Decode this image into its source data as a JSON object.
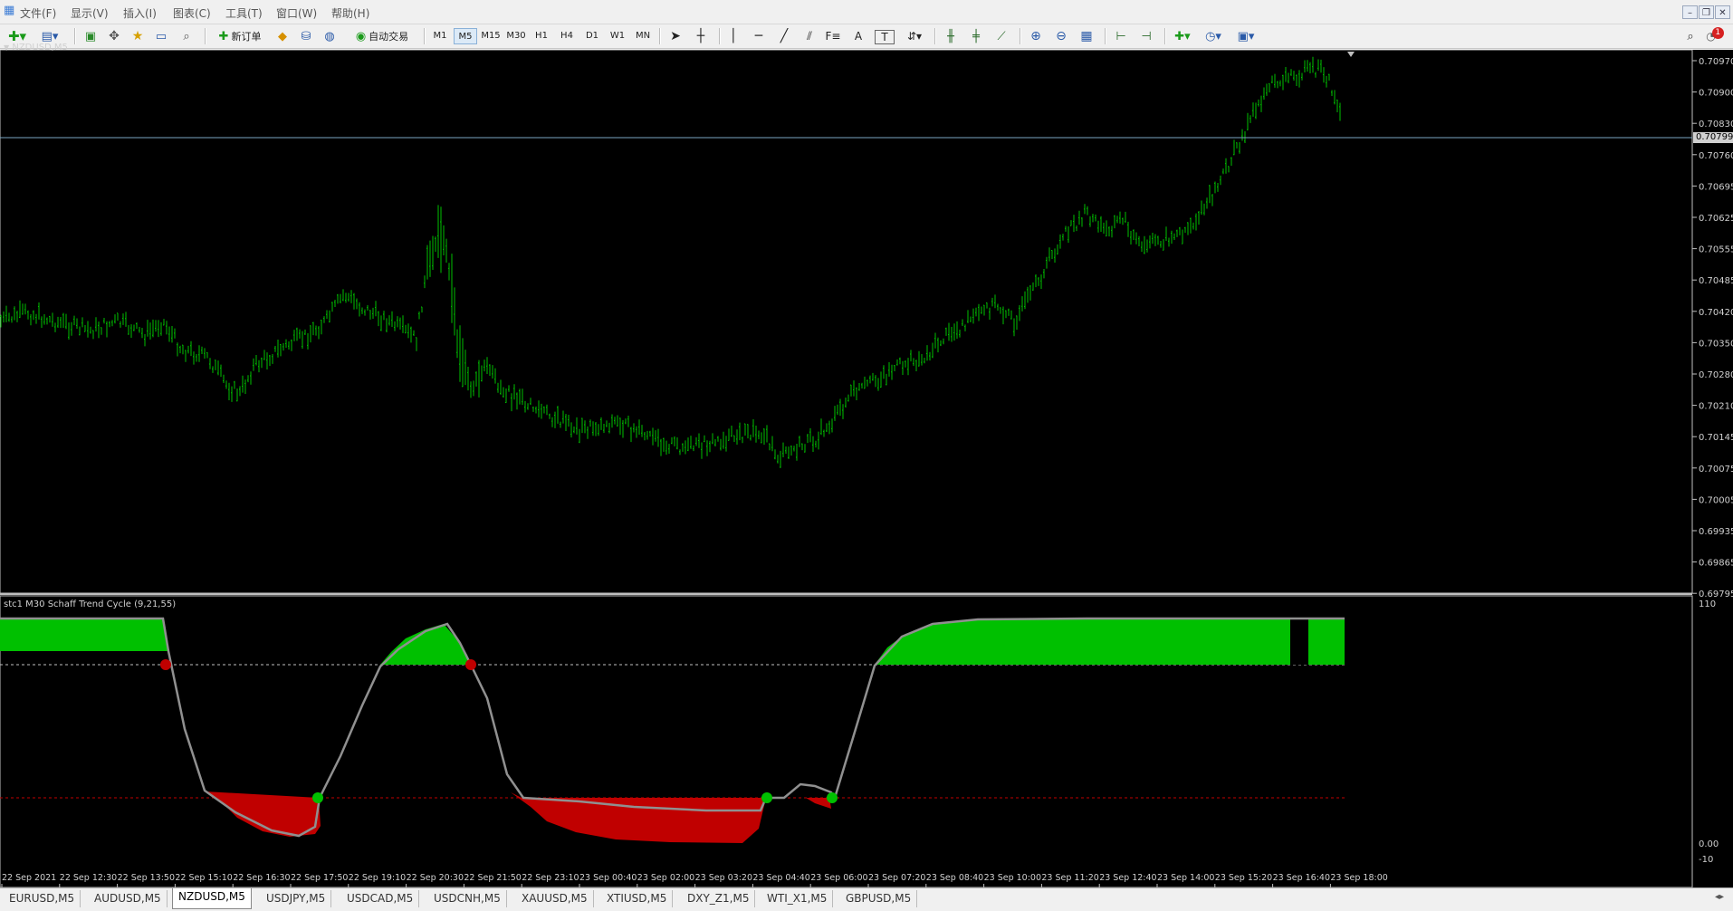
{
  "menu": [
    "文件(F)",
    "显示(V)",
    "插入(I)",
    "图表(C)",
    "工具(T)",
    "窗口(W)",
    "帮助(H)"
  ],
  "toolbar": {
    "new_order_label": "新订单",
    "auto_trade_label": "自动交易",
    "timeframes": [
      "M1",
      "M5",
      "M15",
      "M30",
      "H1",
      "H4",
      "D1",
      "W1",
      "MN"
    ],
    "active_timeframe": "M5",
    "text_tool_label": "A",
    "notification_count": "1"
  },
  "chart": {
    "title": "NZDUSD,M5",
    "current_price": "0.70799",
    "price_ticks": [
      "0.70970",
      "0.70900",
      "0.70830",
      "0.70760",
      "0.70695",
      "0.70625",
      "0.70555",
      "0.70485",
      "0.70420",
      "0.70350",
      "0.70280",
      "0.70210",
      "0.70145",
      "0.70075",
      "0.70005",
      "0.69935",
      "0.69865",
      "0.69795"
    ],
    "time_ticks": [
      "22 Sep 2021",
      "22 Sep 12:30",
      "22 Sep 13:50",
      "22 Sep 15:10",
      "22 Sep 16:30",
      "22 Sep 17:50",
      "22 Sep 19:10",
      "22 Sep 20:30",
      "22 Sep 21:50",
      "22 Sep 23:10",
      "23 Sep 00:40",
      "23 Sep 02:00",
      "23 Sep 03:20",
      "23 Sep 04:40",
      "23 Sep 06:00",
      "23 Sep 07:20",
      "23 Sep 08:40",
      "23 Sep 10:00",
      "23 Sep 11:20",
      "23 Sep 12:40",
      "23 Sep 14:00",
      "23 Sep 15:20",
      "23 Sep 16:40",
      "23 Sep 18:00"
    ],
    "bar_color": "#00c000",
    "price_line_color": "#7aa6c2"
  },
  "indicator": {
    "title": "stc1 M30 Schaff Trend Cycle (9,21,55)",
    "axis_top": "110",
    "axis_zero": "0.00",
    "axis_bottom": "-10",
    "up_color": "#00c000",
    "down_color": "#c00000"
  },
  "tabs": [
    "EURUSD,M5",
    "AUDUSD,M5",
    "NZDUSD,M5",
    "USDJPY,M5",
    "USDCAD,M5",
    "USDCNH,M5",
    "XAUUSD,M5",
    "XTIUSD,M5",
    "DXY_Z1,M5",
    "WTI_X1,M5",
    "GBPUSD,M5"
  ],
  "active_tab": "NZDUSD,M5"
}
